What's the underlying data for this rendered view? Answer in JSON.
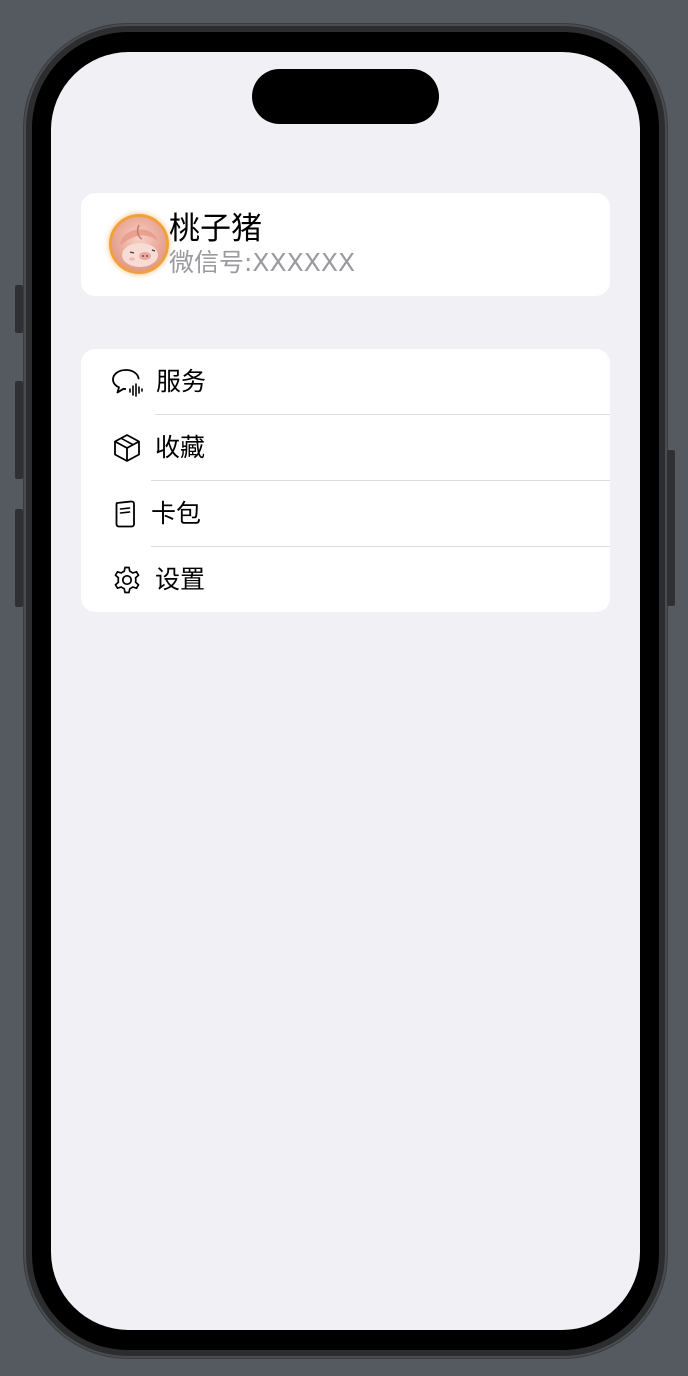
{
  "profile": {
    "name": "桃子猪",
    "wechat_id": "微信号:XXXXXX",
    "avatar": "peach-pig-avatar",
    "accent_color": "#f0a03c"
  },
  "menu": {
    "items": [
      {
        "label": "服务",
        "icon": "chat-bubble-waveform-icon"
      },
      {
        "label": "收藏",
        "icon": "cube-icon"
      },
      {
        "label": "卡包",
        "icon": "card-book-icon"
      },
      {
        "label": "设置",
        "icon": "gear-icon"
      }
    ]
  },
  "colors": {
    "screen_background": "#f0f0f5",
    "card_background": "#ffffff",
    "secondary_text": "#9a9a9f",
    "divider": "#dcdce0"
  }
}
